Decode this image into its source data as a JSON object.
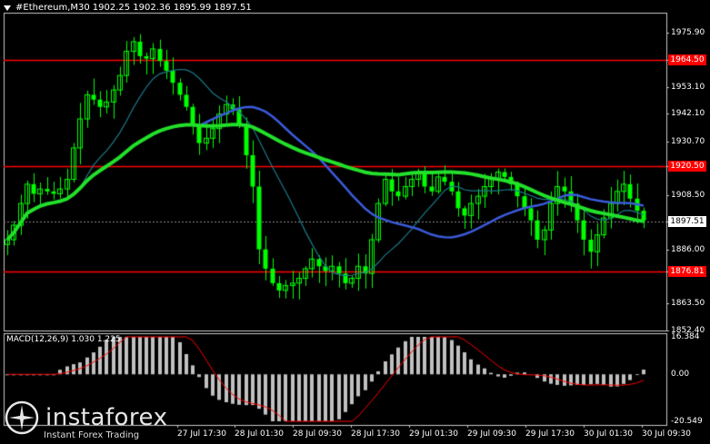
{
  "header": {
    "symbol": "#Ethereum,M30",
    "ohlc": "1902.25 1902.36 1895.99 1897.51"
  },
  "levels": [
    {
      "value": 1964.5,
      "label": "1964.50"
    },
    {
      "value": 1920.5,
      "label": "1920.50"
    },
    {
      "value": 1876.81,
      "label": "1876.81"
    }
  ],
  "current_price": {
    "value": 1897.51,
    "label": "1897.51"
  },
  "y_axis": {
    "min": 1852.4,
    "max": 1984.0,
    "ticks": [
      "1975.90",
      "1964.50",
      "1953.10",
      "1942.10",
      "1930.70",
      "1920.50",
      "1908.50",
      "1897.51",
      "1886.00",
      "1876.81",
      "1863.50",
      "1852.40"
    ]
  },
  "x_axis": {
    "ticks": [
      "27 Jul 17:30",
      "28 Jul 01:30",
      "28 Jul 09:30",
      "28 Jul 17:30",
      "29 Jul 01:30",
      "29 Jul 09:30",
      "29 Jul 17:30",
      "30 Jul 01:30",
      "30 Jul 09:30"
    ]
  },
  "macd": {
    "label": "MACD(12,26,9) 1.030 1.225",
    "ticks": [
      "16.384",
      "0.00",
      "-20.549"
    ],
    "min": -20.549,
    "max": 16.384
  },
  "watermark": {
    "name": "instaforex",
    "tagline": "Instant Forex Trading"
  },
  "colors": {
    "background": "#000000",
    "candle": "#00ff00",
    "ma_fast": "#1b7a8a",
    "ma_mid": "#3b5bdb",
    "ma_slow": "#22e02a",
    "level": "#ff0000",
    "macd_hist": "#c0c0c0",
    "macd_signal": "#ff0000",
    "grid": "#c8c8c8"
  },
  "chart_data": {
    "type": "candlestick",
    "symbol": "#Ethereum",
    "timeframe": "M30",
    "series": [
      {
        "values": [
          1890,
          1896,
          1905,
          1913,
          1909,
          1911,
          1910,
          1909,
          1911,
          1915,
          1928,
          1940,
          1950,
          1948,
          1945,
          1947,
          1952,
          1958,
          1968,
          1972,
          1966,
          1965,
          1969,
          1964,
          1960,
          1955,
          1950,
          1945,
          1937,
          1930,
          1932,
          1936,
          1942,
          1946,
          1944,
          1938,
          1925,
          1912,
          1886,
          1878,
          1872,
          1869,
          1871,
          1872,
          1874,
          1878,
          1882,
          1879,
          1877,
          1879,
          1876,
          1872,
          1874,
          1879,
          1876,
          1890,
          1905,
          1915,
          1910,
          1908,
          1912,
          1915,
          1918,
          1912,
          1910,
          1916,
          1914,
          1910,
          1903,
          1900,
          1905,
          1908,
          1912,
          1915,
          1918,
          1916,
          1913,
          1908,
          1903,
          1898,
          1890,
          1894,
          1905,
          1912,
          1910,
          1905,
          1898,
          1890,
          1885,
          1892,
          1899,
          1905,
          1910,
          1913,
          1907,
          1902,
          1898
        ]
      }
    ]
  }
}
